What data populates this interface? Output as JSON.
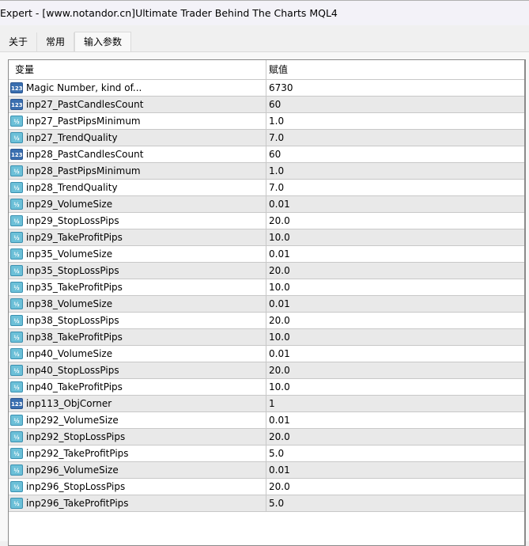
{
  "window": {
    "title": "Expert - [www.notandor.cn]Ultimate Trader Behind The Charts  MQL4"
  },
  "tabs": [
    {
      "label": "关于"
    },
    {
      "label": "常用"
    },
    {
      "label": "输入参数"
    }
  ],
  "table": {
    "headers": {
      "variable": "变量",
      "value": "赋值"
    },
    "rows": [
      {
        "name": "Magic Number, kind of...",
        "value": "6730",
        "type": "int"
      },
      {
        "name": "inp27_PastCandlesCount",
        "value": "60",
        "type": "int"
      },
      {
        "name": "inp27_PastPipsMinimum",
        "value": "1.0",
        "type": "double"
      },
      {
        "name": "inp27_TrendQuality",
        "value": "7.0",
        "type": "double"
      },
      {
        "name": "inp28_PastCandlesCount",
        "value": "60",
        "type": "int"
      },
      {
        "name": "inp28_PastPipsMinimum",
        "value": "1.0",
        "type": "double"
      },
      {
        "name": "inp28_TrendQuality",
        "value": "7.0",
        "type": "double"
      },
      {
        "name": "inp29_VolumeSize",
        "value": "0.01",
        "type": "double"
      },
      {
        "name": "inp29_StopLossPips",
        "value": "20.0",
        "type": "double"
      },
      {
        "name": "inp29_TakeProfitPips",
        "value": "10.0",
        "type": "double"
      },
      {
        "name": "inp35_VolumeSize",
        "value": "0.01",
        "type": "double"
      },
      {
        "name": "inp35_StopLossPips",
        "value": "20.0",
        "type": "double"
      },
      {
        "name": "inp35_TakeProfitPips",
        "value": "10.0",
        "type": "double"
      },
      {
        "name": "inp38_VolumeSize",
        "value": "0.01",
        "type": "double"
      },
      {
        "name": "inp38_StopLossPips",
        "value": "20.0",
        "type": "double"
      },
      {
        "name": "inp38_TakeProfitPips",
        "value": "10.0",
        "type": "double"
      },
      {
        "name": "inp40_VolumeSize",
        "value": "0.01",
        "type": "double"
      },
      {
        "name": "inp40_StopLossPips",
        "value": "20.0",
        "type": "double"
      },
      {
        "name": "inp40_TakeProfitPips",
        "value": "10.0",
        "type": "double"
      },
      {
        "name": "inp113_ObjCorner",
        "value": "1",
        "type": "int"
      },
      {
        "name": "inp292_VolumeSize",
        "value": "0.01",
        "type": "double"
      },
      {
        "name": "inp292_StopLossPips",
        "value": "20.0",
        "type": "double"
      },
      {
        "name": "inp292_TakeProfitPips",
        "value": "5.0",
        "type": "double"
      },
      {
        "name": "inp296_VolumeSize",
        "value": "0.01",
        "type": "double"
      },
      {
        "name": "inp296_StopLossPips",
        "value": "20.0",
        "type": "double"
      },
      {
        "name": "inp296_TakeProfitPips",
        "value": "5.0",
        "type": "double"
      }
    ]
  },
  "icons": {
    "int": "123",
    "double": "½"
  }
}
